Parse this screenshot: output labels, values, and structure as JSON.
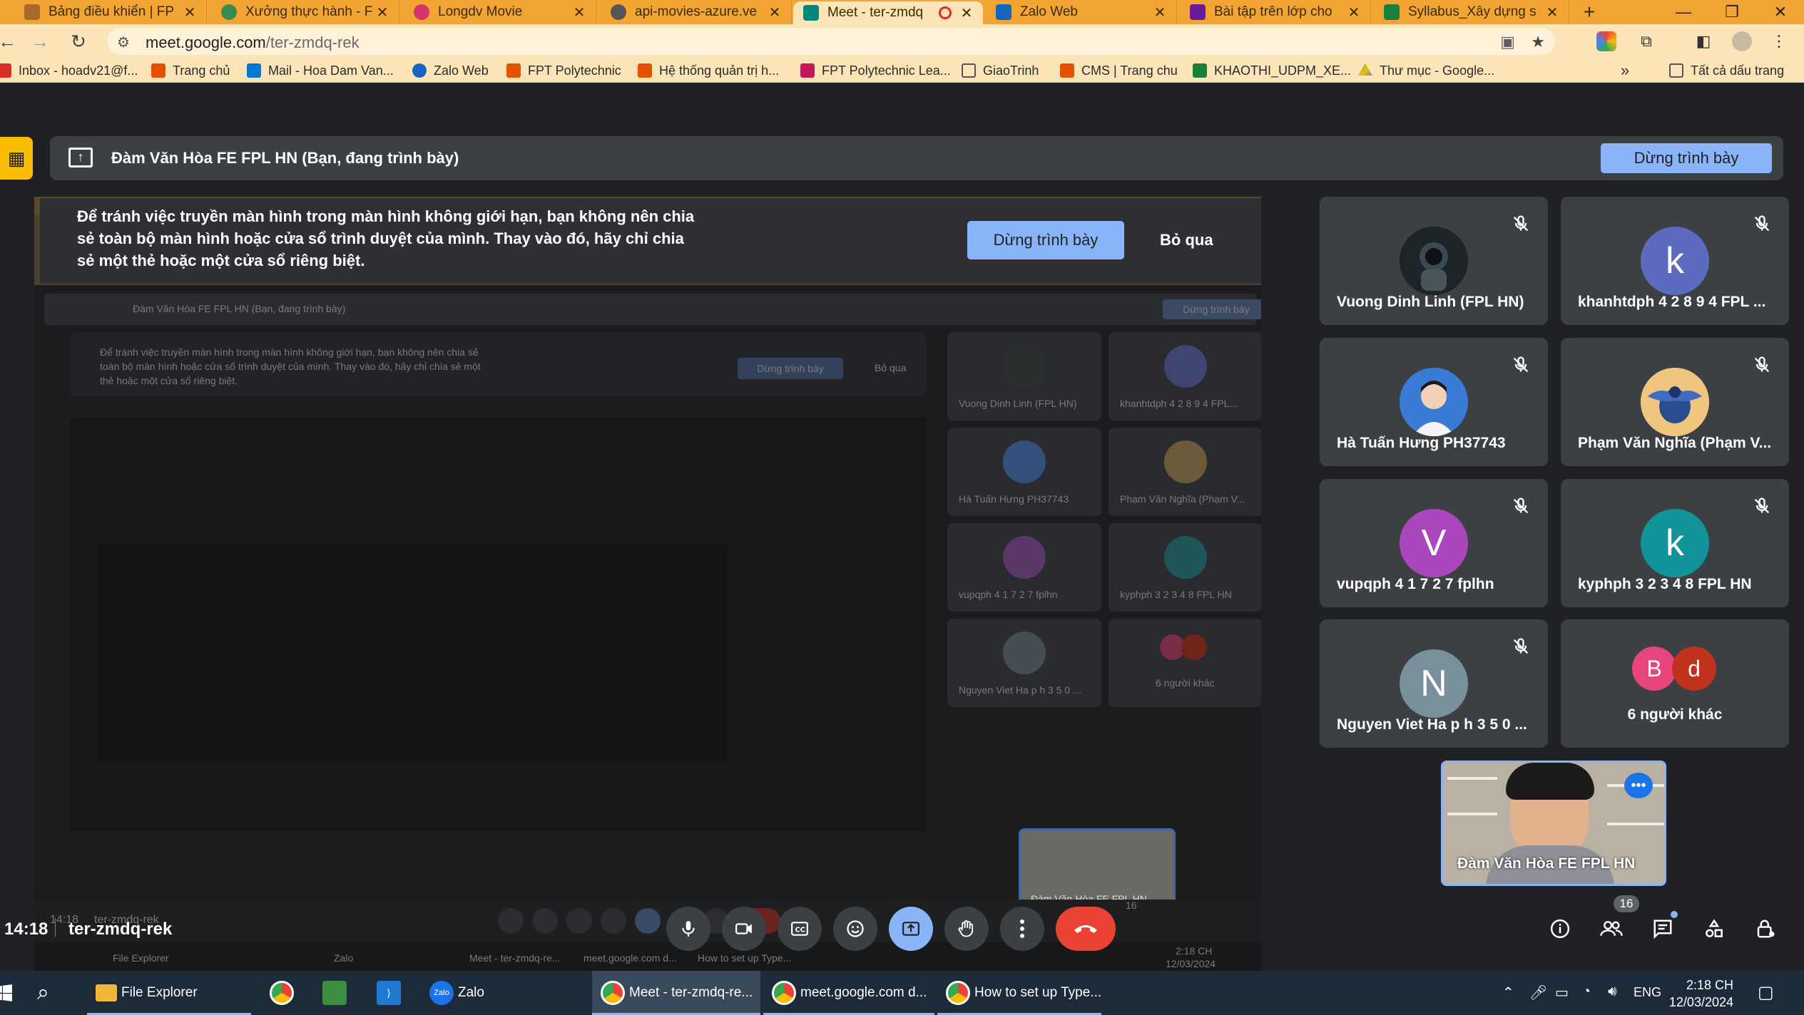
{
  "browser": {
    "tabs": [
      {
        "title": "Bảng điều khiển | FP",
        "icon_color": "#a86a2c",
        "active": false
      },
      {
        "title": "Xưởng thực hành - F",
        "icon_color": "#3a8a4a",
        "active": false
      },
      {
        "title": "Longdv Movie",
        "icon_color": "#d6336c",
        "active": false
      },
      {
        "title": "api-movies-azure.ve",
        "icon_color": "#555555",
        "active": false
      },
      {
        "title": "Meet - ter-zmdq",
        "icon_color": "#00897b",
        "active": true
      },
      {
        "title": "Zalo Web",
        "icon_color": "#1565c0",
        "active": false
      },
      {
        "title": "Bài tập trên lớp cho",
        "icon_color": "#6a1b9a",
        "active": false
      },
      {
        "title": "Syllabus_Xây dựng s",
        "icon_color": "#188038",
        "active": false
      }
    ],
    "url_host": "meet.google.com",
    "url_path": "/ter-zmdq-rek",
    "bookmarks": [
      {
        "label": "Inbox - hoadv21@f...",
        "color": "#d93025"
      },
      {
        "label": "Trang chủ",
        "color": "#e65100"
      },
      {
        "label": "Mail - Hoa Dam Van...",
        "color": "#0078d4"
      },
      {
        "label": "Zalo Web",
        "color": "#1565c0"
      },
      {
        "label": "FPT Polytechnic",
        "color": "#e65100"
      },
      {
        "label": "Hệ thống quản trị h...",
        "color": "#e65100"
      },
      {
        "label": "FPT Polytechnic Lea...",
        "color": "#c2185b"
      },
      {
        "label": "GiaoTrinh",
        "color": "#555555"
      },
      {
        "label": "CMS | Trang chu",
        "color": "#e65100"
      },
      {
        "label": "KHAOTHI_UDPM_XE...",
        "color": "#188038"
      },
      {
        "label": "Thư mục - Google...",
        "color": "#fbbc04"
      }
    ],
    "all_bookmarks": "Tất cả dấu trang"
  },
  "meet": {
    "presenter_text": "Đàm Văn Hòa FE FPL HN (Bạn, đang trình bày)",
    "stop_presenting": "Dừng trình bày",
    "warning_text": "Để tránh việc truyền màn hình trong màn hình không giới hạn, bạn không nên chia sẻ toàn bộ màn hình hoặc cửa sổ trình duyệt của mình. Thay vào đó, hãy chỉ chia sẻ một thẻ hoặc một cửa sổ riêng biệt.",
    "warning_stop": "Dừng trình bày",
    "warning_skip": "Bỏ qua",
    "participants": [
      {
        "name": "Vuong Dinh Linh (FPL HN)",
        "initial": "",
        "color": "#1e2a2e"
      },
      {
        "name": "khanhtdph 4 2 8 9 4 FPL ...",
        "initial": "k",
        "color": "#5c6bc0"
      },
      {
        "name": "Hà Tuấn Hưng PH37743",
        "initial": "",
        "color": "#3a7bd5"
      },
      {
        "name": "Phạm Văn Nghĩa (Phạm V...",
        "initial": "",
        "color": "#e9b872"
      },
      {
        "name": "vupqph 4 1 7 2 7 fplhn",
        "initial": "V",
        "color": "#ab47bc"
      },
      {
        "name": "kyphph 3 2 3 4 8 FPL HN",
        "initial": "k",
        "color": "#12939a"
      },
      {
        "name": "Nguyen Viet Ha p h 3 5 0 ...",
        "initial": "N",
        "color": "#78909c"
      }
    ],
    "others": {
      "label": "6 người khác",
      "initial1": "B",
      "initial2": "d"
    },
    "self_name": "Đàm Văn Hòa FE FPL HN",
    "time": "14:18",
    "meeting_code": "ter-zmdq-rek",
    "participant_count": "16"
  },
  "shared_screen": {
    "presenter_text": "Đàm Văn Hòa FE FPL HN (Bạn, đang trình bày)",
    "stop": "Dừng trình bày",
    "warning_line1": "Để tránh việc truyền màn hình trong màn hình không giới hạn, bạn không nên chia sẻ",
    "warning_line2": "toàn bộ màn hình hoặc cửa sổ trình duyệt của mình. Thay vào đó, hãy chỉ chia sẻ một",
    "warning_line3": "thẻ hoặc một cửa sổ riêng biệt.",
    "skip": "Bỏ qua",
    "names": [
      "Vuong Dinh Linh (FPL HN)",
      "khanhtdph 4 2 8 9 4 FPL...",
      "Hà Tuấn Hưng PH37743",
      "Phạm Văn Nghĩa (Phạm V...",
      "vupqph 4 1 7 2 7 fplhn",
      "kyphph 3 2 3 4 8 FPL HN",
      "Nguyen Viet Ha p h 3 5 0 ...",
      "6 người khác"
    ],
    "self_name": "Đàm Văn Hòa FE FPL HN",
    "time": "14:18",
    "code": "ter-zmdq-rek",
    "count": "16",
    "task_items": [
      "File Explorer",
      "Zalo",
      "Meet - ter-zmdq-re...",
      "meet.google.com d...",
      "How to set up Type..."
    ],
    "clock_time": "2:18 CH",
    "clock_date": "12/03/2024"
  },
  "taskbar": {
    "items": [
      {
        "label": "File Explorer",
        "color": "#f2b736"
      },
      {
        "label": "",
        "color": "#e8453c"
      },
      {
        "label": "",
        "color": "#3c8d3f"
      },
      {
        "label": "",
        "color": "#1f7ad1"
      },
      {
        "label": "Zalo",
        "color": "#1a73e8"
      },
      {
        "label": "Meet - ter-zmdq-re...",
        "color": "#e8453c"
      },
      {
        "label": "meet.google.com d...",
        "color": "#e8453c"
      },
      {
        "label": "How to set up Type...",
        "color": "#e8453c"
      }
    ],
    "lang": "ENG",
    "clock_time": "2:18 CH",
    "clock_date": "12/03/2024"
  }
}
